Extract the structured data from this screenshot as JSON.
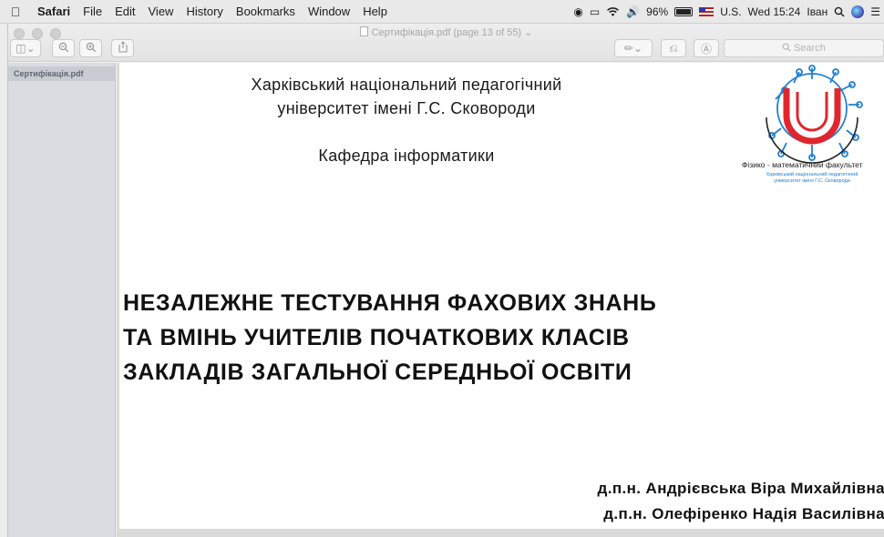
{
  "menubar": {
    "app": "Safari",
    "items": [
      "File",
      "Edit",
      "View",
      "History",
      "Bookmarks",
      "Window",
      "Help"
    ],
    "battery_percent": "96%",
    "battery_fill": 0.96,
    "input_source": "U.S.",
    "clock": "Wed 15:24",
    "user": "Іван"
  },
  "window": {
    "title": "Сертифікація.pdf (page 13 of 55)",
    "search_placeholder": "Search"
  },
  "sidebar": {
    "items": [
      {
        "label": "Сертифікація.pdf"
      }
    ]
  },
  "document": {
    "university_line1": "Харківський національний педагогічний",
    "university_line2": "університет імені Г.С. Сковороди",
    "department": "Кафедра інформатики",
    "logo_caption": "Фізико - математичний факультет",
    "logo_subcaption_line1": "Харківський національний педагогічний",
    "logo_subcaption_line2": "університет імені Г.С. Сковороди",
    "title_line1": "НЕЗАЛЕЖНЕ ТЕСТУВАННЯ ФАХОВИХ ЗНАНЬ",
    "title_line2": "ТА ВМІНЬ УЧИТЕЛІВ ПОЧАТКОВИХ КЛАСІВ",
    "title_line3": "ЗАКЛАДІВ ЗАГАЛЬНОЇ СЕРЕДНЬОЇ ОСВІТИ",
    "author1": "д.п.н. Андрієвська Віра Михайлівна",
    "author2": "д.п.н. Олефіренко Надія Василівна"
  },
  "colors": {
    "logo_blue": "#1f7fd0",
    "logo_red": "#e0262d"
  },
  "icons": {
    "menubar": [
      "apple-icon",
      "screen-record-icon",
      "screen-mirror-icon",
      "wifi-icon",
      "volume-icon",
      "battery-icon",
      "flag-icon",
      "spotlight-icon",
      "siri-icon",
      "notification-center-icon"
    ],
    "toolbar": [
      "sidebar-toggle-icon",
      "zoom-out-icon",
      "zoom-in-icon",
      "share-icon",
      "markup-pen-icon",
      "rotate-icon",
      "annotate-icon",
      "search-icon"
    ]
  }
}
